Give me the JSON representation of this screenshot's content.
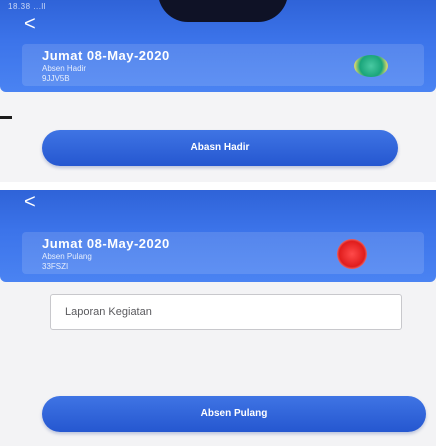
{
  "screen_top": {
    "status_text": "18.38 ...ll ",
    "back_glyph": "<",
    "card": {
      "date": "Jumat 08-May-2020",
      "type": "Absen Hadir",
      "code": "9JJV5B"
    },
    "status_color": "#1aa57a",
    "button_label": "Abasn Hadir"
  },
  "screen_bottom": {
    "back_glyph": "<",
    "card": {
      "date": "Jumat 08-May-2020",
      "type": "Absen Pulang",
      "code": "33FSZI"
    },
    "status_color": "#e01d1d",
    "report_placeholder": "Laporan Kegiatan",
    "button_label": "Absen Pulang"
  }
}
